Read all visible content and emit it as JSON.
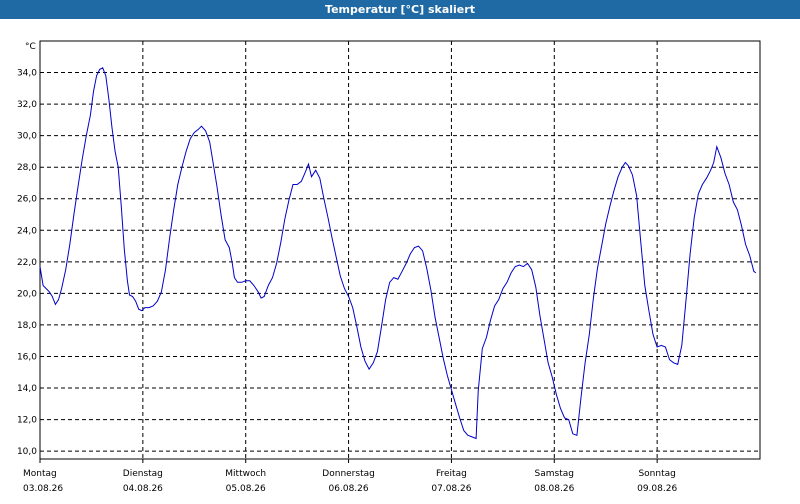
{
  "window": {
    "title": "Temperatur [°C] skaliert"
  },
  "chart_data": {
    "type": "line",
    "title": "Temperatur [°C] skaliert",
    "ylabel": "°C",
    "xlabel": "",
    "ylim": [
      9.5,
      36.0
    ],
    "yticks": [
      "10,0",
      "12,0",
      "14,0",
      "16,0",
      "18,0",
      "20,0",
      "22,0",
      "24,0",
      "26,0",
      "28,0",
      "30,0",
      "32,0",
      "34,0"
    ],
    "ytick_values": [
      10,
      12,
      14,
      16,
      18,
      20,
      22,
      24,
      26,
      28,
      30,
      32,
      34
    ],
    "xlim": [
      0,
      7
    ],
    "xticks": [
      {
        "day": "Montag",
        "date": "03.08.26",
        "x": 0
      },
      {
        "day": "Dienstag",
        "date": "04.08.26",
        "x": 1
      },
      {
        "day": "Mittwoch",
        "date": "05.08.26",
        "x": 2
      },
      {
        "day": "Donnerstag",
        "date": "06.08.26",
        "x": 3
      },
      {
        "day": "Freitag",
        "date": "07.08.26",
        "x": 4
      },
      {
        "day": "Samstag",
        "date": "08.08.26",
        "x": 5
      },
      {
        "day": "Sonntag",
        "date": "09.08.26",
        "x": 6
      }
    ],
    "grid": true,
    "line_color": "#0000cc",
    "series": [
      {
        "name": "",
        "points": [
          [
            0.0,
            21.7
          ],
          [
            0.03,
            20.5
          ],
          [
            0.06,
            20.3
          ],
          [
            0.09,
            20.1
          ],
          [
            0.12,
            19.8
          ],
          [
            0.15,
            19.3
          ],
          [
            0.18,
            19.6
          ],
          [
            0.21,
            20.3
          ],
          [
            0.25,
            21.5
          ],
          [
            0.29,
            23.1
          ],
          [
            0.33,
            25.0
          ],
          [
            0.37,
            26.8
          ],
          [
            0.41,
            28.5
          ],
          [
            0.45,
            30.0
          ],
          [
            0.49,
            31.3
          ],
          [
            0.52,
            32.8
          ],
          [
            0.55,
            33.8
          ],
          [
            0.58,
            34.2
          ],
          [
            0.61,
            34.3
          ],
          [
            0.64,
            33.8
          ],
          [
            0.67,
            32.3
          ],
          [
            0.7,
            30.5
          ],
          [
            0.73,
            29.0
          ],
          [
            0.76,
            28.0
          ],
          [
            0.79,
            25.5
          ],
          [
            0.82,
            22.8
          ],
          [
            0.85,
            20.8
          ],
          [
            0.87,
            19.9
          ],
          [
            0.9,
            19.8
          ],
          [
            0.93,
            19.5
          ],
          [
            0.96,
            19.0
          ],
          [
            0.99,
            18.9
          ],
          [
            1.02,
            19.1
          ],
          [
            1.06,
            19.1
          ],
          [
            1.1,
            19.2
          ],
          [
            1.14,
            19.5
          ],
          [
            1.18,
            20.1
          ],
          [
            1.22,
            21.5
          ],
          [
            1.26,
            23.5
          ],
          [
            1.3,
            25.3
          ],
          [
            1.34,
            26.9
          ],
          [
            1.38,
            28.0
          ],
          [
            1.42,
            29.0
          ],
          [
            1.46,
            29.8
          ],
          [
            1.5,
            30.2
          ],
          [
            1.54,
            30.4
          ],
          [
            1.57,
            30.6
          ],
          [
            1.61,
            30.3
          ],
          [
            1.65,
            29.6
          ],
          [
            1.68,
            28.4
          ],
          [
            1.72,
            26.8
          ],
          [
            1.76,
            25.0
          ],
          [
            1.8,
            23.4
          ],
          [
            1.84,
            22.9
          ],
          [
            1.87,
            21.9
          ],
          [
            1.89,
            21.0
          ],
          [
            1.92,
            20.7
          ],
          [
            1.96,
            20.7
          ],
          [
            2.0,
            20.8
          ],
          [
            2.04,
            20.8
          ],
          [
            2.08,
            20.5
          ],
          [
            2.12,
            20.1
          ],
          [
            2.15,
            19.7
          ],
          [
            2.18,
            19.8
          ],
          [
            2.22,
            20.5
          ],
          [
            2.26,
            21.0
          ],
          [
            2.3,
            21.9
          ],
          [
            2.34,
            23.2
          ],
          [
            2.38,
            24.7
          ],
          [
            2.42,
            25.9
          ],
          [
            2.46,
            26.9
          ],
          [
            2.5,
            26.9
          ],
          [
            2.54,
            27.1
          ],
          [
            2.58,
            27.7
          ],
          [
            2.61,
            28.2
          ],
          [
            2.64,
            27.4
          ],
          [
            2.68,
            27.8
          ],
          [
            2.72,
            27.3
          ],
          [
            2.76,
            26.0
          ],
          [
            2.8,
            24.8
          ],
          [
            2.84,
            23.5
          ],
          [
            2.88,
            22.3
          ],
          [
            2.92,
            21.1
          ],
          [
            2.96,
            20.3
          ],
          [
            3.0,
            19.8
          ],
          [
            3.04,
            19.1
          ],
          [
            3.08,
            17.9
          ],
          [
            3.12,
            16.6
          ],
          [
            3.16,
            15.7
          ],
          [
            3.2,
            15.2
          ],
          [
            3.24,
            15.6
          ],
          [
            3.28,
            16.3
          ],
          [
            3.32,
            17.9
          ],
          [
            3.36,
            19.6
          ],
          [
            3.4,
            20.7
          ],
          [
            3.44,
            21.0
          ],
          [
            3.48,
            20.9
          ],
          [
            3.52,
            21.4
          ],
          [
            3.56,
            21.9
          ],
          [
            3.6,
            22.5
          ],
          [
            3.64,
            22.9
          ],
          [
            3.68,
            23.0
          ],
          [
            3.72,
            22.7
          ],
          [
            3.76,
            21.6
          ],
          [
            3.8,
            20.2
          ],
          [
            3.84,
            18.5
          ],
          [
            3.88,
            17.2
          ],
          [
            3.92,
            15.9
          ],
          [
            3.96,
            14.8
          ],
          [
            4.0,
            13.9
          ],
          [
            4.04,
            13.0
          ],
          [
            4.08,
            12.1
          ],
          [
            4.12,
            11.3
          ],
          [
            4.16,
            11.0
          ],
          [
            4.2,
            10.9
          ],
          [
            4.24,
            10.8
          ],
          [
            4.26,
            13.8
          ],
          [
            4.3,
            16.5
          ],
          [
            4.34,
            17.2
          ],
          [
            4.38,
            18.3
          ],
          [
            4.42,
            19.2
          ],
          [
            4.46,
            19.6
          ],
          [
            4.5,
            20.3
          ],
          [
            4.54,
            20.7
          ],
          [
            4.58,
            21.3
          ],
          [
            4.62,
            21.7
          ],
          [
            4.66,
            21.8
          ],
          [
            4.7,
            21.7
          ],
          [
            4.74,
            21.9
          ],
          [
            4.78,
            21.5
          ],
          [
            4.82,
            20.4
          ],
          [
            4.86,
            18.6
          ],
          [
            4.9,
            17.1
          ],
          [
            4.94,
            15.6
          ],
          [
            4.98,
            14.7
          ],
          [
            5.02,
            13.6
          ],
          [
            5.06,
            12.7
          ],
          [
            5.1,
            12.1
          ],
          [
            5.14,
            12.0
          ],
          [
            5.18,
            11.1
          ],
          [
            5.22,
            11.0
          ],
          [
            5.26,
            13.4
          ],
          [
            5.3,
            15.6
          ],
          [
            5.34,
            17.4
          ],
          [
            5.38,
            19.7
          ],
          [
            5.42,
            21.6
          ],
          [
            5.46,
            23.0
          ],
          [
            5.5,
            24.4
          ],
          [
            5.54,
            25.5
          ],
          [
            5.58,
            26.5
          ],
          [
            5.62,
            27.4
          ],
          [
            5.66,
            28.0
          ],
          [
            5.69,
            28.3
          ],
          [
            5.72,
            28.1
          ],
          [
            5.76,
            27.5
          ],
          [
            5.8,
            26.2
          ],
          [
            5.84,
            23.3
          ],
          [
            5.88,
            20.5
          ],
          [
            5.92,
            18.9
          ],
          [
            5.96,
            17.4
          ],
          [
            6.0,
            16.6
          ],
          [
            6.04,
            16.7
          ],
          [
            6.08,
            16.6
          ],
          [
            6.12,
            15.8
          ],
          [
            6.16,
            15.6
          ],
          [
            6.2,
            15.5
          ],
          [
            6.24,
            16.7
          ],
          [
            6.28,
            19.5
          ],
          [
            6.32,
            22.5
          ],
          [
            6.36,
            24.8
          ],
          [
            6.4,
            26.3
          ],
          [
            6.44,
            26.9
          ],
          [
            6.48,
            27.3
          ],
          [
            6.52,
            27.8
          ],
          [
            6.55,
            28.3
          ],
          [
            6.58,
            29.3
          ],
          [
            6.62,
            28.6
          ],
          [
            6.66,
            27.6
          ],
          [
            6.7,
            26.9
          ],
          [
            6.74,
            25.8
          ],
          [
            6.78,
            25.3
          ],
          [
            6.82,
            24.3
          ],
          [
            6.86,
            23.1
          ],
          [
            6.9,
            22.4
          ],
          [
            6.94,
            21.4
          ],
          [
            6.96,
            21.3
          ]
        ]
      }
    ]
  }
}
